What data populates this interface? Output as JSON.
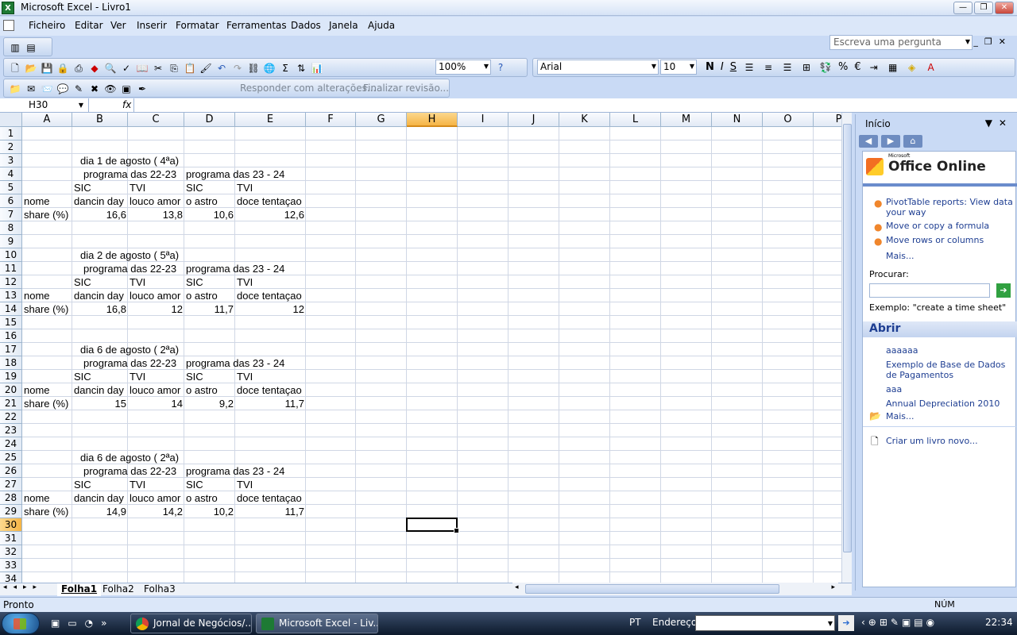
{
  "window": {
    "title": "Microsoft Excel - Livro1",
    "app_icon": "excel-icon"
  },
  "menu": {
    "items": [
      "Ficheiro",
      "Editar",
      "Ver",
      "Inserir",
      "Formatar",
      "Ferramentas",
      "Dados",
      "Janela",
      "Ajuda"
    ],
    "ask_placeholder": "Escreva uma pergunta"
  },
  "toolbar": {
    "zoom": "100%",
    "font": "Arial",
    "font_size": "10",
    "bold": "N",
    "italic": "I",
    "underline": "S",
    "percent": "%",
    "euro": "€",
    "sum": "Σ",
    "help": "?"
  },
  "review_toolbar": {
    "reply_label": "Responder com alterações...",
    "end_review_label": "Finalizar revisão..."
  },
  "formula_bar": {
    "name_box": "H30",
    "fx": "fx",
    "content": ""
  },
  "grid": {
    "columns": [
      "A",
      "B",
      "C",
      "D",
      "E",
      "F",
      "G",
      "H",
      "I",
      "J",
      "K",
      "L",
      "M",
      "N",
      "O",
      "P"
    ],
    "rows": [
      "1",
      "2",
      "3",
      "4",
      "5",
      "6",
      "7",
      "8",
      "9",
      "10",
      "11",
      "12",
      "13",
      "14",
      "15",
      "16",
      "17",
      "18",
      "19",
      "20",
      "21",
      "22",
      "23",
      "24",
      "25",
      "26",
      "27",
      "28",
      "29",
      "30",
      "31",
      "32",
      "33",
      "34"
    ],
    "selected_column": "H",
    "selected_row": "30",
    "cells": [
      {
        "c": "B",
        "r": 3,
        "v": "dia 1 de agosto ( 4ªa)",
        "align": "left",
        "indent": 8
      },
      {
        "c": "B",
        "r": 4,
        "v": "programa das 22-23",
        "align": "left",
        "indent": 12
      },
      {
        "c": "D",
        "r": 4,
        "v": "programa das 23 - 24",
        "align": "left"
      },
      {
        "c": "B",
        "r": 5,
        "v": "SIC",
        "align": "left"
      },
      {
        "c": "C",
        "r": 5,
        "v": "TVI",
        "align": "left"
      },
      {
        "c": "D",
        "r": 5,
        "v": "SIC",
        "align": "left"
      },
      {
        "c": "E",
        "r": 5,
        "v": "TVI",
        "align": "left"
      },
      {
        "c": "A",
        "r": 6,
        "v": "nome",
        "align": "left"
      },
      {
        "c": "B",
        "r": 6,
        "v": "dancin day",
        "align": "left"
      },
      {
        "c": "C",
        "r": 6,
        "v": "louco amor",
        "align": "left"
      },
      {
        "c": "D",
        "r": 6,
        "v": "o astro",
        "align": "left"
      },
      {
        "c": "E",
        "r": 6,
        "v": "doce tentaçao",
        "align": "left"
      },
      {
        "c": "A",
        "r": 7,
        "v": "share (%)",
        "align": "left"
      },
      {
        "c": "B",
        "r": 7,
        "v": "16,6",
        "align": "right"
      },
      {
        "c": "C",
        "r": 7,
        "v": "13,8",
        "align": "right"
      },
      {
        "c": "D",
        "r": 7,
        "v": "10,6",
        "align": "right"
      },
      {
        "c": "E",
        "r": 7,
        "v": "12,6",
        "align": "right"
      },
      {
        "c": "B",
        "r": 10,
        "v": "dia 2 de agosto ( 5ªa)",
        "align": "left",
        "indent": 8
      },
      {
        "c": "B",
        "r": 11,
        "v": "programa das 22-23",
        "align": "left",
        "indent": 12
      },
      {
        "c": "D",
        "r": 11,
        "v": "programa das 23 - 24",
        "align": "left"
      },
      {
        "c": "B",
        "r": 12,
        "v": "SIC",
        "align": "left"
      },
      {
        "c": "C",
        "r": 12,
        "v": "TVI",
        "align": "left"
      },
      {
        "c": "D",
        "r": 12,
        "v": "SIC",
        "align": "left"
      },
      {
        "c": "E",
        "r": 12,
        "v": "TVI",
        "align": "left"
      },
      {
        "c": "A",
        "r": 13,
        "v": "nome",
        "align": "left"
      },
      {
        "c": "B",
        "r": 13,
        "v": "dancin day",
        "align": "left"
      },
      {
        "c": "C",
        "r": 13,
        "v": "louco amor",
        "align": "left"
      },
      {
        "c": "D",
        "r": 13,
        "v": "o astro",
        "align": "left"
      },
      {
        "c": "E",
        "r": 13,
        "v": "doce tentaçao",
        "align": "left"
      },
      {
        "c": "A",
        "r": 14,
        "v": "share (%)",
        "align": "left"
      },
      {
        "c": "B",
        "r": 14,
        "v": "16,8",
        "align": "right"
      },
      {
        "c": "C",
        "r": 14,
        "v": "12",
        "align": "right"
      },
      {
        "c": "D",
        "r": 14,
        "v": "11,7",
        "align": "right"
      },
      {
        "c": "E",
        "r": 14,
        "v": "12",
        "align": "right"
      },
      {
        "c": "B",
        "r": 17,
        "v": "dia 6 de agosto ( 2ªa)",
        "align": "left",
        "indent": 8
      },
      {
        "c": "B",
        "r": 18,
        "v": "programa das 22-23",
        "align": "left",
        "indent": 12
      },
      {
        "c": "D",
        "r": 18,
        "v": "programa das 23 - 24",
        "align": "left"
      },
      {
        "c": "B",
        "r": 19,
        "v": "SIC",
        "align": "left"
      },
      {
        "c": "C",
        "r": 19,
        "v": "TVI",
        "align": "left"
      },
      {
        "c": "D",
        "r": 19,
        "v": "SIC",
        "align": "left"
      },
      {
        "c": "E",
        "r": 19,
        "v": "TVI",
        "align": "left"
      },
      {
        "c": "A",
        "r": 20,
        "v": "nome",
        "align": "left"
      },
      {
        "c": "B",
        "r": 20,
        "v": "dancin day",
        "align": "left"
      },
      {
        "c": "C",
        "r": 20,
        "v": "louco amor",
        "align": "left"
      },
      {
        "c": "D",
        "r": 20,
        "v": "o astro",
        "align": "left"
      },
      {
        "c": "E",
        "r": 20,
        "v": "doce tentaçao",
        "align": "left"
      },
      {
        "c": "A",
        "r": 21,
        "v": "share (%)",
        "align": "left"
      },
      {
        "c": "B",
        "r": 21,
        "v": "15",
        "align": "right"
      },
      {
        "c": "C",
        "r": 21,
        "v": "14",
        "align": "right"
      },
      {
        "c": "D",
        "r": 21,
        "v": "9,2",
        "align": "right"
      },
      {
        "c": "E",
        "r": 21,
        "v": "11,7",
        "align": "right"
      },
      {
        "c": "B",
        "r": 25,
        "v": "dia 6 de agosto ( 2ªa)",
        "align": "left",
        "indent": 8
      },
      {
        "c": "B",
        "r": 26,
        "v": "programa das 22-23",
        "align": "left",
        "indent": 12
      },
      {
        "c": "D",
        "r": 26,
        "v": "programa das 23 - 24",
        "align": "left"
      },
      {
        "c": "B",
        "r": 27,
        "v": "SIC",
        "align": "left"
      },
      {
        "c": "C",
        "r": 27,
        "v": "TVI",
        "align": "left"
      },
      {
        "c": "D",
        "r": 27,
        "v": "SIC",
        "align": "left"
      },
      {
        "c": "E",
        "r": 27,
        "v": "TVI",
        "align": "left"
      },
      {
        "c": "A",
        "r": 28,
        "v": "nome",
        "align": "left"
      },
      {
        "c": "B",
        "r": 28,
        "v": "dancin day",
        "align": "left"
      },
      {
        "c": "C",
        "r": 28,
        "v": "louco amor",
        "align": "left"
      },
      {
        "c": "D",
        "r": 28,
        "v": "o astro",
        "align": "left"
      },
      {
        "c": "E",
        "r": 28,
        "v": "doce tentaçao",
        "align": "left"
      },
      {
        "c": "A",
        "r": 29,
        "v": "share (%)",
        "align": "left"
      },
      {
        "c": "B",
        "r": 29,
        "v": "14,9",
        "align": "right"
      },
      {
        "c": "C",
        "r": 29,
        "v": "14,2",
        "align": "right"
      },
      {
        "c": "D",
        "r": 29,
        "v": "10,2",
        "align": "right"
      },
      {
        "c": "E",
        "r": 29,
        "v": "11,7",
        "align": "right"
      }
    ]
  },
  "sheets": {
    "tabs": [
      "Folha1",
      "Folha2",
      "Folha3"
    ],
    "active": "Folha1"
  },
  "status": {
    "text": "Pronto",
    "num": "NÚM"
  },
  "task_pane": {
    "title": "Início",
    "brand_small": "Microsoft",
    "brand": "Office Online",
    "links": [
      "PivotTable reports: View data your way",
      "Move or copy a formula",
      "Move rows or columns"
    ],
    "more": "Mais...",
    "search_label": "Procurar:",
    "search_value": "",
    "example": "Exemplo:  \"create a time sheet\"",
    "open_header": "Abrir",
    "recent": [
      "aaaaaa",
      "Exemplo de Base de Dados de Pagamentos",
      "aaa",
      "Annual Depreciation 2010"
    ],
    "open_more": "Mais...",
    "new_workbook": "Criar um livro novo..."
  },
  "taskbar": {
    "tasks": [
      "Jornal de Negócios/...",
      "Microsoft Excel - Liv..."
    ],
    "lang": "PT",
    "address_label": "Endereço",
    "address_value": "",
    "clock": "22:34"
  },
  "colors": {
    "accent": "#1e3e92",
    "selection_header": "#f6b445",
    "chrome": "#c9daf5"
  }
}
